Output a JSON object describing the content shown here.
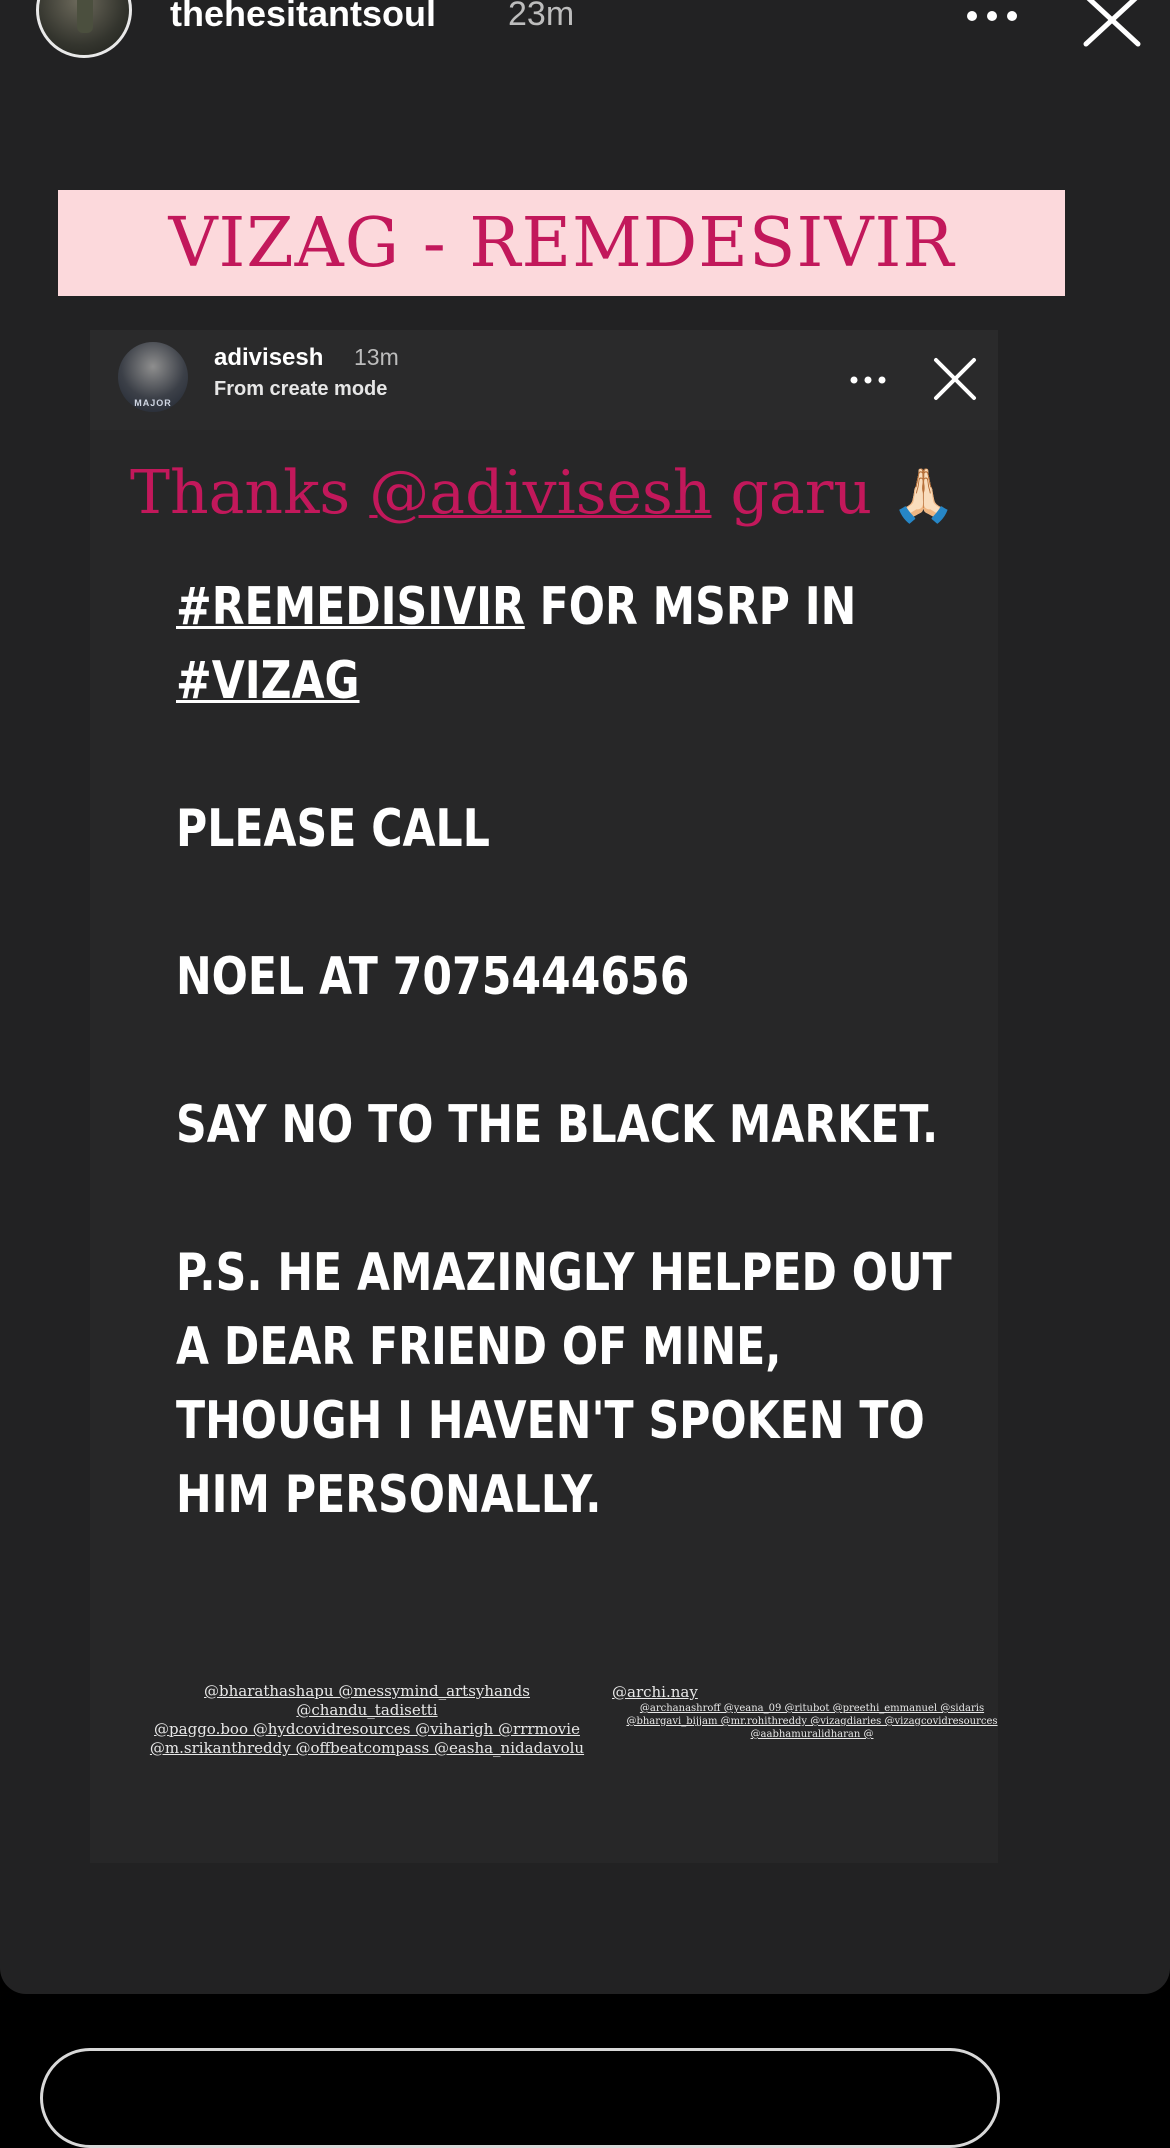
{
  "header": {
    "username": "thehesitantsoul",
    "time": "23m"
  },
  "banner": {
    "text": "VIZAG - REMDESIVIR"
  },
  "shared_story": {
    "username": "adivisesh",
    "time": "13m",
    "subtitle": "From create mode",
    "avatar_label": "MAJOR",
    "thanks_prefix": "Thanks ",
    "thanks_mention": "@adivisesh",
    "thanks_suffix": " garu ",
    "thanks_emoji": "🙏🏻",
    "lines": {
      "l1_tag": "#REMEDISIVIR",
      "l1_rest": " FOR MSRP IN",
      "l2_tag": "#VIZAG",
      "l3": "PLEASE CALL",
      "l4": "NOEL AT 7075444656",
      "l5": "SAY NO TO THE BLACK MARKET.",
      "l6": "P.S. HE AMAZINGLY HELPED OUT",
      "l7": "A DEAR FRIEND OF MINE,",
      "l8": "THOUGH I HAVEN'T SPOKEN TO",
      "l9": "HIM PERSONALLY."
    },
    "tags_left": [
      "@bharathashapu @messymind_artsyhands @chandu_tadisetti",
      "@paggo.boo @hydcovidresources @viharigh @rrrmovie",
      "@m.srikanthreddy @offbeatcompass @easha_nidadavolu"
    ],
    "tags_right_big": "@archi.nay",
    "tags_right": [
      "@archanashroff @yeana_09 @ritubot @preethi_emmanuel @sidaris",
      "@bhargavi_bijjam @mr.rohithreddy @vizagdiaries @vizagcovidresources",
      "@aabhamuralidharan @"
    ]
  },
  "icons": {
    "more": "more-horizontal-icon",
    "close": "close-icon"
  },
  "colors": {
    "background": "#222223",
    "banner_bg": "#fcd9dc",
    "accent_pink": "#c2185b"
  }
}
